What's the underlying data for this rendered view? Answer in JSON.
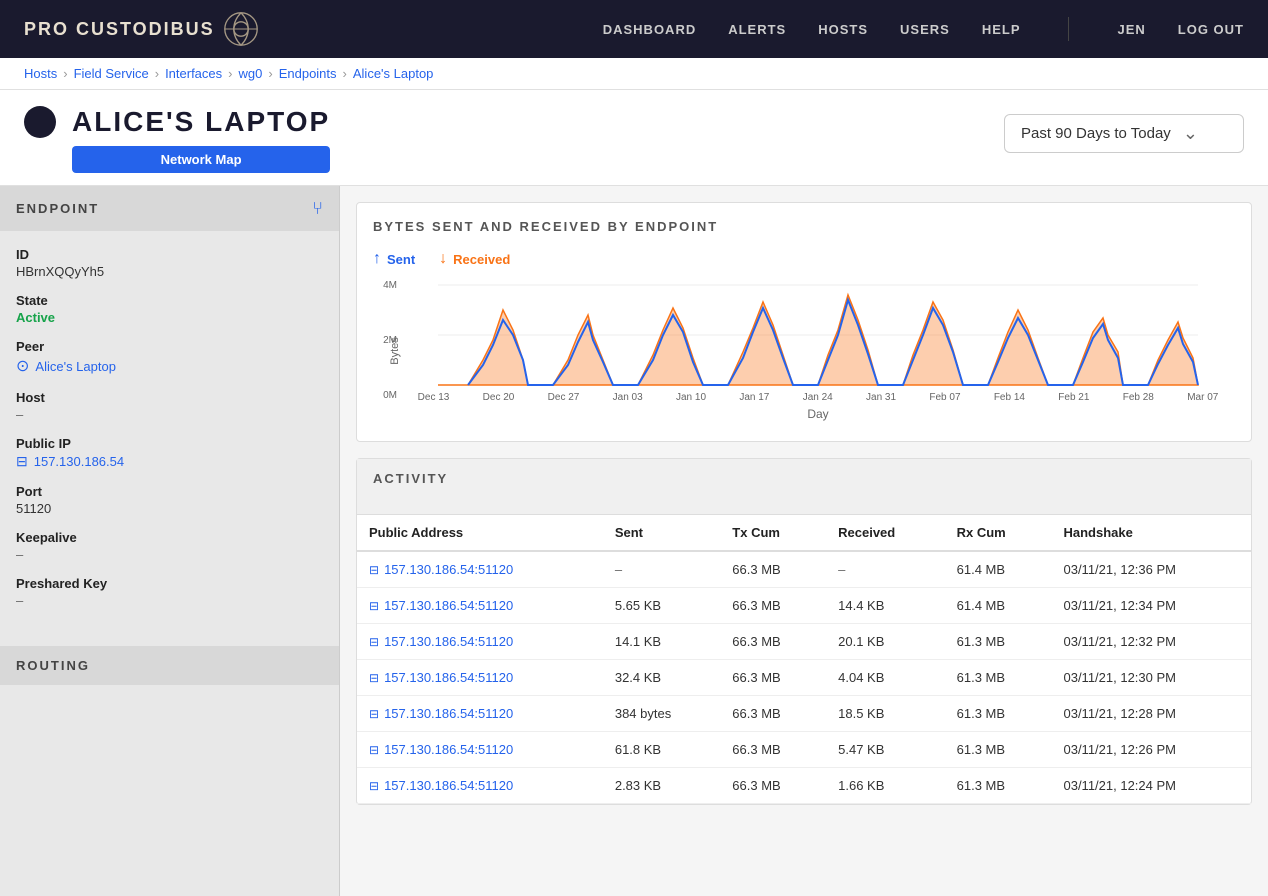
{
  "app": {
    "title": "Pro Custodibus"
  },
  "nav": {
    "links": [
      {
        "label": "DASHBOARD",
        "href": "#"
      },
      {
        "label": "ALERTS",
        "href": "#"
      },
      {
        "label": "HOSTS",
        "href": "#"
      },
      {
        "label": "USERS",
        "href": "#"
      },
      {
        "label": "HELP",
        "href": "#"
      },
      {
        "label": "JEN",
        "href": "#"
      },
      {
        "label": "LOG OUT",
        "href": "#"
      }
    ]
  },
  "breadcrumb": {
    "items": [
      {
        "label": "Hosts",
        "href": "#",
        "active": false
      },
      {
        "label": "Field Service",
        "href": "#",
        "active": false
      },
      {
        "label": "Interfaces",
        "href": "#",
        "active": false
      },
      {
        "label": "wg0",
        "href": "#",
        "active": false
      },
      {
        "label": "Endpoints",
        "href": "#",
        "active": false
      },
      {
        "label": "Alice's Laptop",
        "href": "#",
        "active": true
      }
    ]
  },
  "page": {
    "title": "ALICE'S LAPTOP",
    "network_map_btn": "Network Map",
    "date_range": "Past 90 Days to Today"
  },
  "sidebar": {
    "endpoint_title": "ENDPOINT",
    "routing_title": "ROUTING",
    "fields": {
      "id_label": "ID",
      "id_value": "HBrnXQQyYh5",
      "state_label": "State",
      "state_value": "Active",
      "peer_label": "Peer",
      "peer_value": "Alice's Laptop",
      "host_label": "Host",
      "host_value": "–",
      "public_ip_label": "Public IP",
      "public_ip_value": "157.130.186.54",
      "port_label": "Port",
      "port_value": "51120",
      "keepalive_label": "Keepalive",
      "keepalive_value": "–",
      "preshared_key_label": "Preshared Key",
      "preshared_key_value": "–"
    }
  },
  "chart": {
    "title": "BYTES SENT AND RECEIVED BY ENDPOINT",
    "legend": {
      "sent": "Sent",
      "received": "Received"
    },
    "y_axis_labels": [
      "4M",
      "2M",
      "0M"
    ],
    "y_axis_title": "Bytes",
    "x_axis_labels": [
      "Dec 13",
      "Dec 20",
      "Dec 27",
      "Jan 03",
      "Jan 10",
      "Jan 17",
      "Jan 24",
      "Jan 31",
      "Feb 07",
      "Feb 14",
      "Feb 21",
      "Feb 28",
      "Mar 07"
    ],
    "x_axis_title": "Day"
  },
  "activity": {
    "title": "ACTIVITY",
    "columns": [
      "Public Address",
      "Sent",
      "Tx Cum",
      "Received",
      "Rx Cum",
      "Handshake"
    ],
    "rows": [
      {
        "address": "157.130.186.54:51120",
        "sent": "–",
        "tx_cum": "66.3 MB",
        "received": "–",
        "rx_cum": "61.4 MB",
        "handshake": "03/11/21, 12:36 PM"
      },
      {
        "address": "157.130.186.54:51120",
        "sent": "5.65 KB",
        "tx_cum": "66.3 MB",
        "received": "14.4 KB",
        "rx_cum": "61.4 MB",
        "handshake": "03/11/21, 12:34 PM"
      },
      {
        "address": "157.130.186.54:51120",
        "sent": "14.1 KB",
        "tx_cum": "66.3 MB",
        "received": "20.1 KB",
        "rx_cum": "61.3 MB",
        "handshake": "03/11/21, 12:32 PM"
      },
      {
        "address": "157.130.186.54:51120",
        "sent": "32.4 KB",
        "tx_cum": "66.3 MB",
        "received": "4.04 KB",
        "rx_cum": "61.3 MB",
        "handshake": "03/11/21, 12:30 PM"
      },
      {
        "address": "157.130.186.54:51120",
        "sent": "384 bytes",
        "tx_cum": "66.3 MB",
        "received": "18.5 KB",
        "rx_cum": "61.3 MB",
        "handshake": "03/11/21, 12:28 PM"
      },
      {
        "address": "157.130.186.54:51120",
        "sent": "61.8 KB",
        "tx_cum": "66.3 MB",
        "received": "5.47 KB",
        "rx_cum": "61.3 MB",
        "handshake": "03/11/21, 12:26 PM"
      },
      {
        "address": "157.130.186.54:51120",
        "sent": "2.83 KB",
        "tx_cum": "66.3 MB",
        "received": "1.66 KB",
        "rx_cum": "61.3 MB",
        "handshake": "03/11/21, 12:24 PM"
      }
    ]
  }
}
